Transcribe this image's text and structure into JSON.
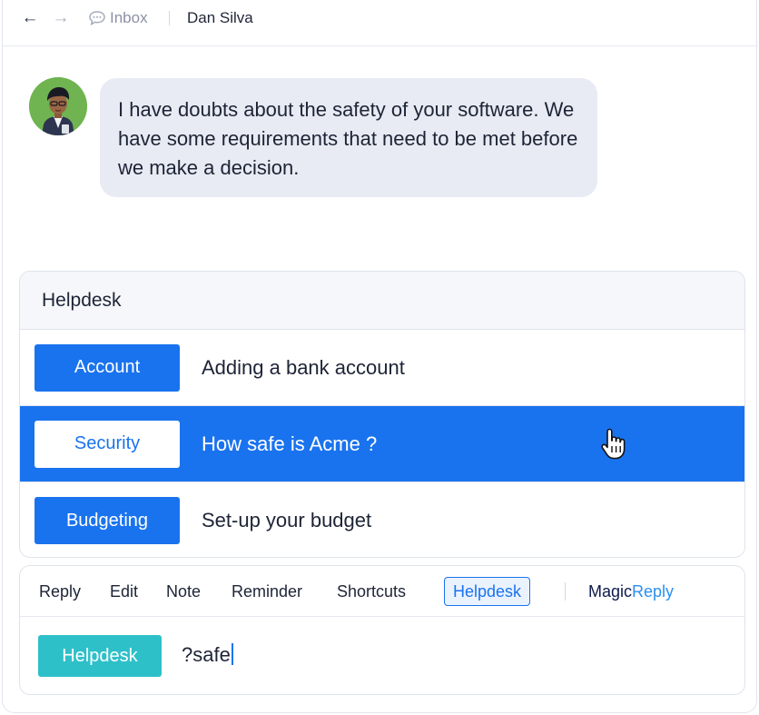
{
  "topbar": {
    "back_icon": "arrow-left-icon",
    "forward_icon": "arrow-right-icon",
    "inbox_icon": "chat-bubble-icon",
    "inbox_label": "Inbox",
    "contact_name": "Dan Silva"
  },
  "message": {
    "text": "I have doubts about the safety of your software. We have some requirements that need to be met before we make a decision."
  },
  "helpdesk": {
    "title": "Helpdesk",
    "articles": [
      {
        "tag": "Account",
        "title": "Adding a bank account",
        "selected": false
      },
      {
        "tag": "Security",
        "title": "How safe is Acme ?",
        "selected": true
      },
      {
        "tag": "Budgeting",
        "title": "Set-up your budget",
        "selected": false
      }
    ]
  },
  "composer": {
    "tabs": [
      "Reply",
      "Edit",
      "Note",
      "Reminder",
      "Shortcuts",
      "Helpdesk"
    ],
    "active_tab": "Helpdesk",
    "magic_part1": "Magic",
    "magic_part2": "Reply",
    "mode_chip": "Helpdesk",
    "query": "?safe"
  },
  "colors": {
    "primary": "#1a73ee",
    "teal": "#2ec0c9",
    "bubble": "#e8ebf3",
    "avatar_bg": "#6fb450"
  }
}
